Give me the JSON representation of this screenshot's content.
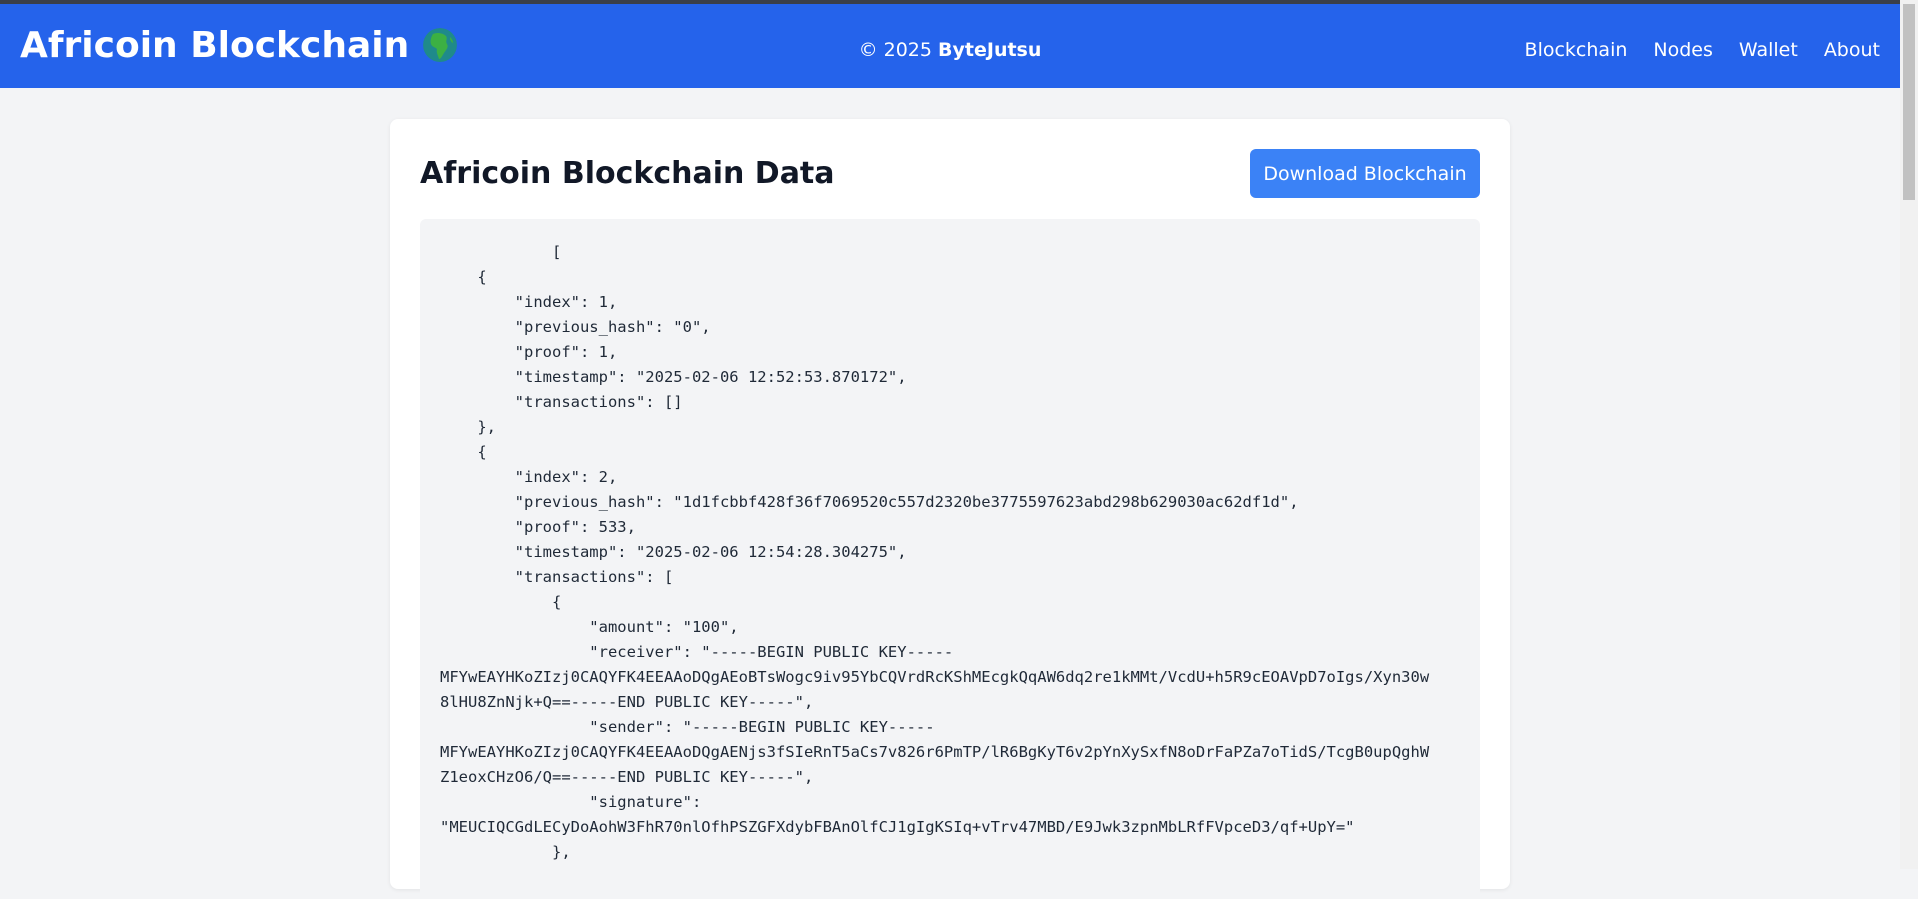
{
  "header": {
    "brand": "Africoin Blockchain",
    "brand_icon": "globe-africa-icon",
    "credit_prefix": "© 2025",
    "credit_name": "ByteJutsu",
    "nav": [
      "Blockchain",
      "Nodes",
      "Wallet",
      "About"
    ]
  },
  "main": {
    "title": "Africoin Blockchain Data",
    "download_label": "Download Blockchain",
    "json_text": "            [\n    {\n        \"index\": 1,\n        \"previous_hash\": \"0\",\n        \"proof\": 1,\n        \"timestamp\": \"2025-02-06 12:52:53.870172\",\n        \"transactions\": []\n    },\n    {\n        \"index\": 2,\n        \"previous_hash\": \"1d1fcbbf428f36f7069520c557d2320be3775597623abd298b629030ac62df1d\",\n        \"proof\": 533,\n        \"timestamp\": \"2025-02-06 12:54:28.304275\",\n        \"transactions\": [\n            {\n                \"amount\": \"100\",\n                \"receiver\": \"-----BEGIN PUBLIC KEY-----\nMFYwEAYHKoZIzj0CAQYFK4EEAAoDQgAEoBTsWogc9iv95YbCQVrdRcKShMEcgkQqAW6dq2re1kMMt/VcdU+h5R9cEOAVpD7oIgs/Xyn30w\n8lHU8ZnNjk+Q==-----END PUBLIC KEY-----\",\n                \"sender\": \"-----BEGIN PUBLIC KEY-----\nMFYwEAYHKoZIzj0CAQYFK4EEAAoDQgAENjs3fSIeRnT5aCs7v826r6PmTP/lR6BgKyT6v2pYnXySxfN8oDrFaPZa7oTidS/TcgB0upQghW\nZ1eoxCHzO6/Q==-----END PUBLIC KEY-----\",\n                \"signature\":\n\"MEUCIQCGdLECyDoAohW3FhR70nlOfhPSZGFXdybFBAnOlfCJ1gIgKSIq+vTrv47MBD/E9Jwk3zpnMbLRfFVpceD3/qf+UpY=\"\n            },"
  }
}
